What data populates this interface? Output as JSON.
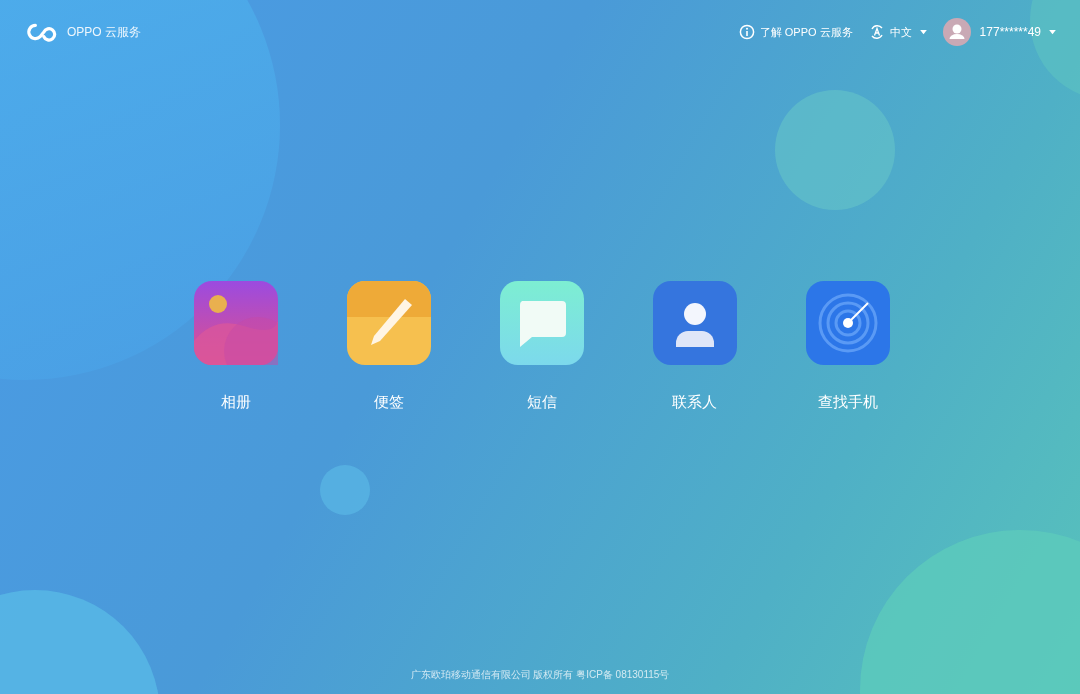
{
  "header": {
    "brand": "OPPO 云服务",
    "about": "了解 OPPO 云服务",
    "language": "中文",
    "account": "177******49"
  },
  "apps": [
    {
      "kind": "gallery",
      "label": "相册"
    },
    {
      "kind": "notes",
      "label": "便签"
    },
    {
      "kind": "messages",
      "label": "短信"
    },
    {
      "kind": "contacts",
      "label": "联系人"
    },
    {
      "kind": "find-phone",
      "label": "查找手机"
    }
  ],
  "footer": "广东欧珀移动通信有限公司 版权所有 粤ICP备 08130115号"
}
